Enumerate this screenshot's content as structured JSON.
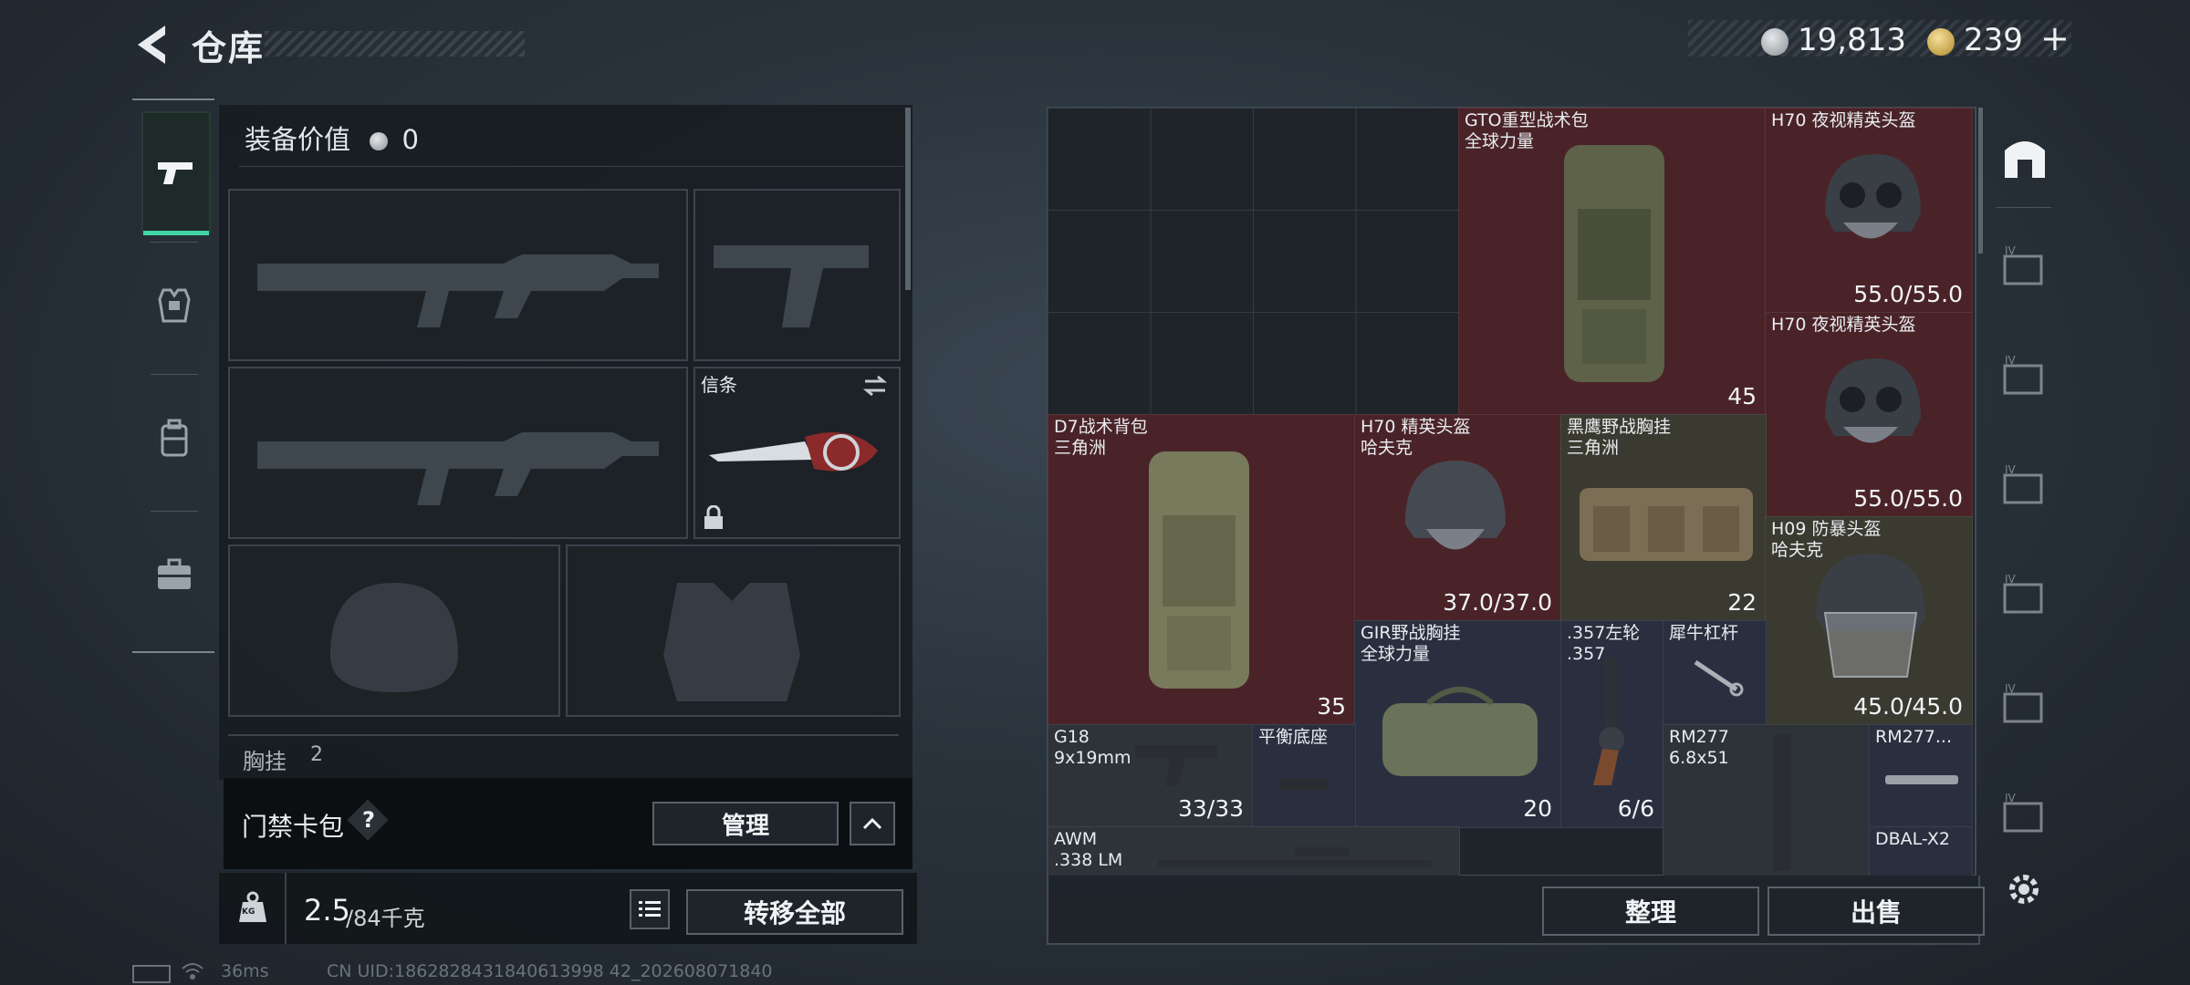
{
  "header": {
    "title": "仓库",
    "coins_a": "19,813",
    "coins_b": "239",
    "add_symbol": "+"
  },
  "loadout": {
    "equip_value_label": "装备价值",
    "equip_value": "0",
    "melee_label": "信条",
    "chest_rig_label": "胸挂",
    "chest_rig_count": "2"
  },
  "keycard": {
    "label": "门禁卡包",
    "help": "?",
    "manage": "管理"
  },
  "weight": {
    "current": "2.5",
    "capacity": "/84千克",
    "transfer_all": "转移全部",
    "kg_icon_text": "KG"
  },
  "grid_items": [
    {
      "name": "GTO重型战术包\n全球力量",
      "value": "45",
      "tint": "red"
    },
    {
      "name": "H70 夜视精英头盔",
      "value": "55.0/55.0",
      "tint": "red"
    },
    {
      "name": "H70 夜视精英头盔",
      "value": "55.0/55.0",
      "tint": "red"
    },
    {
      "name": "D7战术背包\n三角洲",
      "value": "35",
      "tint": "red"
    },
    {
      "name": "H70 精英头盔\n哈夫克",
      "value": "37.0/37.0",
      "tint": "red"
    },
    {
      "name": "黑鹰野战胸挂\n三角洲",
      "value": "22",
      "tint": "olive"
    },
    {
      "name": "H09 防暴头盔\n哈夫克",
      "value": "45.0/45.0",
      "tint": "olive"
    },
    {
      "name": "GIR野战胸挂\n全球力量",
      "value": "20",
      "tint": "navy"
    },
    {
      "name": ".357左轮\n.357",
      "value": "6/6",
      "tint": "navy"
    },
    {
      "name": "犀牛杠杆",
      "value": "",
      "tint": "navy"
    },
    {
      "name": "G18\n9x19mm",
      "value": "33/33",
      "tint": "grey"
    },
    {
      "name": "平衡底座",
      "value": "",
      "tint": "navy"
    },
    {
      "name": "RM277\n6.8x51",
      "value": "",
      "tint": "grey"
    },
    {
      "name": "RM277...",
      "value": "",
      "tint": "navy"
    },
    {
      "name": "AWM\n.338 LM",
      "value": "",
      "tint": "grey"
    },
    {
      "name": "DBAL-X2",
      "value": "",
      "tint": "navy"
    }
  ],
  "actions": {
    "sort": "整理",
    "sell": "出售"
  },
  "status_bar": {
    "ping": "36ms",
    "uid": "CN UID:1862828431840613998 42_202608071840"
  },
  "colors": {
    "accent": "#3fd5a6",
    "red_tile": "#4a2328",
    "olive_tile": "#3b3a30",
    "navy_tile": "#2a2f40"
  }
}
